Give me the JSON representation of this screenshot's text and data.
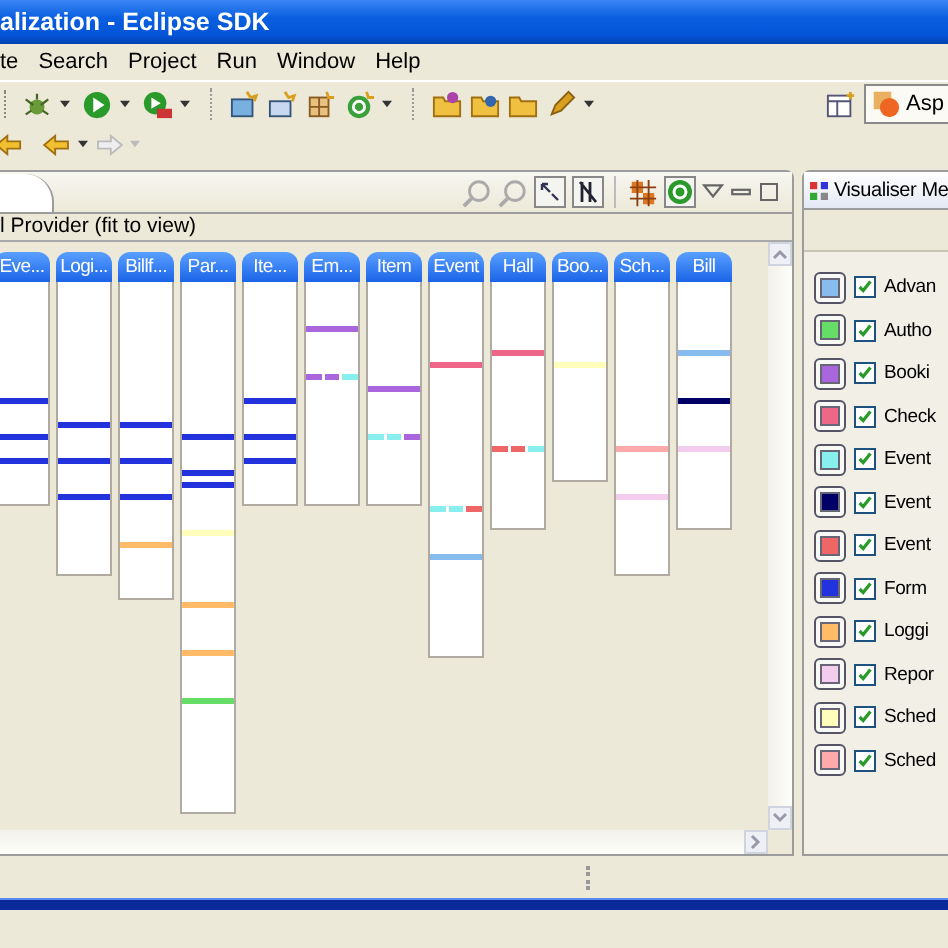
{
  "window": {
    "title": "alization - Eclipse SDK"
  },
  "menu": [
    "te",
    "Search",
    "Project",
    "Run",
    "Window",
    "Help"
  ],
  "perspective": {
    "label": "Asp"
  },
  "view": {
    "subtitle": "l Provider (fit to view)",
    "lanes": [
      {
        "label": "Eve..."
      },
      {
        "label": "Logi..."
      },
      {
        "label": "Billf..."
      },
      {
        "label": "Par..."
      },
      {
        "label": "Ite..."
      },
      {
        "label": "Em..."
      },
      {
        "label": "Item"
      },
      {
        "label": "Event"
      },
      {
        "label": "Hall"
      },
      {
        "label": "Boo..."
      },
      {
        "label": "Sch..."
      },
      {
        "label": "Bill"
      }
    ]
  },
  "legend_view": {
    "title": "Visualiser Me",
    "items": [
      {
        "label": "Advan",
        "color": "#88bbee",
        "checked": true
      },
      {
        "label": "Autho",
        "color": "#66dd66",
        "checked": true
      },
      {
        "label": "Booki",
        "color": "#aa66dd",
        "checked": true
      },
      {
        "label": "Check",
        "color": "#ee6688",
        "checked": true
      },
      {
        "label": "Event",
        "color": "#88eeee",
        "checked": true
      },
      {
        "label": "Event",
        "color": "#000066",
        "checked": true
      },
      {
        "label": "Event",
        "color": "#ee6666",
        "checked": true
      },
      {
        "label": "Form",
        "color": "#2233dd",
        "checked": true
      },
      {
        "label": "Loggi",
        "color": "#ffbb66",
        "checked": true
      },
      {
        "label": "Repor",
        "color": "#f4ccee",
        "checked": true
      },
      {
        "label": "Sched",
        "color": "#ffffbb",
        "checked": true
      },
      {
        "label": "Sched",
        "color": "#ffaaaa",
        "checked": true
      }
    ]
  }
}
